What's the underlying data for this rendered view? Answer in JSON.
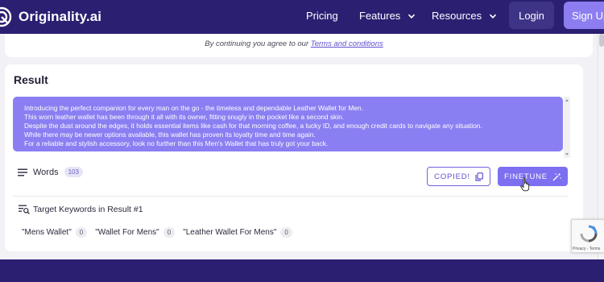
{
  "header": {
    "logo_text": "Originality.ai",
    "nav": [
      {
        "label": "Pricing",
        "dropdown": false
      },
      {
        "label": "Features",
        "dropdown": true
      },
      {
        "label": "Resources",
        "dropdown": true
      }
    ],
    "login_label": "Login",
    "signup_label": "Sign Up"
  },
  "terms": {
    "prefix": "By continuing you agree to our",
    "link": "Terms and conditions"
  },
  "result": {
    "title": "Result",
    "lines": [
      "Introducing the perfect companion for every man on the go - the timeless and dependable Leather Wallet for Men.",
      "This worn leather wallet has been through it all with its owner, fitting snugly in the pocket like a second skin.",
      "Despite the dust around the edges, it holds essential items like cash for that morning coffee, a lucky ID, and enough credit cards to navigate any situation.",
      "While there may be newer options available, this wallet has proven its loyalty time and time again.",
      "For a reliable and stylish accessory, look no further than this Men's Wallet that has truly got your back."
    ],
    "words_label": "Words",
    "word_count": "103",
    "copied_label": "COPIED!",
    "finetune_label": "FINETUNE"
  },
  "keywords": {
    "title": "Target Keywords in Result #1",
    "items": [
      {
        "text": "\"Mens Wallet\"",
        "count": "0"
      },
      {
        "text": "\"Wallet For Mens\"",
        "count": "0"
      },
      {
        "text": "\"Leather Wallet For Mens\"",
        "count": "0"
      }
    ]
  },
  "recaptcha": {
    "links": "Privacy - Terms"
  },
  "colors": {
    "header_bg": "#2b1f72",
    "accent": "#7c6ff0",
    "result_box": "#8a7ff2",
    "signup_btn": "#8c7ef0"
  },
  "icons": [
    "originality-logo-icon",
    "chevron-down-icon",
    "menu-lines-icon",
    "copy-icon",
    "magic-wand-icon",
    "keyword-search-icon",
    "hand-cursor-icon",
    "recaptcha-icon"
  ]
}
